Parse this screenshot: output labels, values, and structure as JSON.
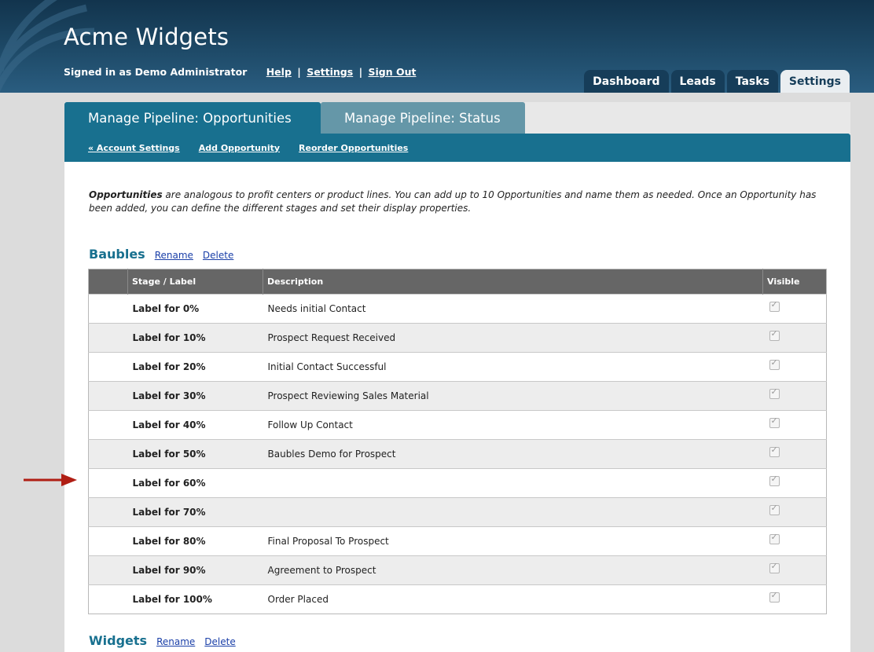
{
  "header": {
    "title": "Acme Widgets",
    "signed_in": "Signed in as Demo Administrator",
    "links": [
      "Help",
      "Settings",
      "Sign Out"
    ],
    "link_separator": "|"
  },
  "main_tabs": [
    "Dashboard",
    "Leads",
    "Tasks",
    "Settings"
  ],
  "active_main_tab": "Settings",
  "sub_tabs": [
    "Manage Pipeline: Opportunities",
    "Manage Pipeline: Status"
  ],
  "sub_nav": [
    "« Account Settings",
    "Add Opportunity",
    "Reorder Opportunities"
  ],
  "intro": {
    "bold": "Opportunities",
    "rest": " are analogous to profit centers or product lines. You can add up to 10 Opportunities and name them as needed. Once an Opportunity has been added, you can define the different stages and set their display properties."
  },
  "sections": [
    {
      "title": "Baubles",
      "rename": "Rename",
      "delete": "Delete",
      "columns": [
        "",
        "Stage / Label",
        "Description",
        "Visible"
      ],
      "rows": [
        {
          "label": "Label for 0%",
          "description": "Needs initial Contact",
          "visible": true
        },
        {
          "label": "Label for 10%",
          "description": "Prospect Request Received",
          "visible": true
        },
        {
          "label": "Label for 20%",
          "description": "Initial Contact Successful",
          "visible": true
        },
        {
          "label": "Label for 30%",
          "description": "Prospect Reviewing Sales Material",
          "visible": true
        },
        {
          "label": "Label for 40%",
          "description": "Follow Up Contact",
          "visible": true
        },
        {
          "label": "Label for 50%",
          "description": "Baubles Demo for Prospect",
          "visible": true
        },
        {
          "label": "Label for 60%",
          "description": "",
          "visible": true
        },
        {
          "label": "Label for 70%",
          "description": "",
          "visible": true
        },
        {
          "label": "Label for 80%",
          "description": "Final Proposal To Prospect",
          "visible": true
        },
        {
          "label": "Label for 90%",
          "description": "Agreement to Prospect",
          "visible": true
        },
        {
          "label": "Label for 100%",
          "description": "Order Placed",
          "visible": true
        }
      ]
    },
    {
      "title": "Widgets",
      "rename": "Rename",
      "delete": "Delete"
    }
  ],
  "colors": {
    "header_dark": "#12344d",
    "teal": "#18708f",
    "tab_inactive": "#6597a8",
    "table_header": "#666666",
    "arrow": "#b01e14"
  }
}
